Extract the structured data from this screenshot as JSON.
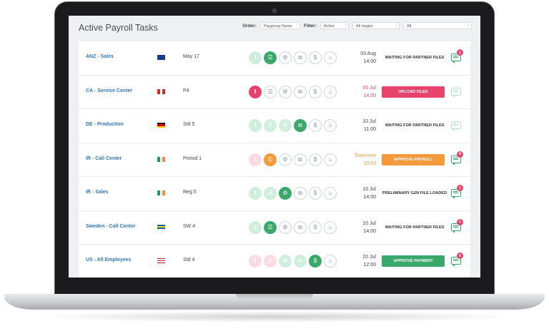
{
  "header": {
    "title": "Active Payroll Tasks",
    "order_label": "Order:",
    "order_value": "Paygroup Name",
    "filter_label": "Filter:",
    "filter_status": "Active",
    "filter_stages": "All stages",
    "filter_all": "All"
  },
  "colors": {
    "green": "#3aa86b",
    "green_light": "#cfeedd",
    "pink": "#e8436d",
    "pink_light": "#fadbe3",
    "orange": "#f39a3d",
    "orange_light": "#fde3c9",
    "link": "#3277b7"
  },
  "stage_icons": [
    "pause-icon",
    "document-icon",
    "gears-icon",
    "copy-icon",
    "money-bag-icon",
    "bank-icon"
  ],
  "rows": [
    {
      "name": "ANZ - Sales",
      "flag": "australia-flag",
      "period": "May 17",
      "stages": [
        "done-green",
        "active-green",
        "future",
        "future",
        "future",
        "future"
      ],
      "date": "03 Aug",
      "time": "14:00",
      "late": false,
      "status": "WAITING FOR PARTNER FILES",
      "status_kind": "text",
      "badge": "1",
      "chat_muted": false
    },
    {
      "name": "CA - Service Center",
      "flag": "canada-flag",
      "period": "P4",
      "stages": [
        "active-pink",
        "future",
        "future",
        "future",
        "future",
        "future"
      ],
      "date": "05 Jul",
      "time": "14:00",
      "late": true,
      "status": "UPLOAD FILES",
      "status_kind": "pink",
      "badge": "",
      "chat_muted": true
    },
    {
      "name": "DE - Production",
      "flag": "germany-flag",
      "period": "Std 5",
      "stages": [
        "done-green",
        "done-green",
        "done-green",
        "active-green",
        "future",
        "future"
      ],
      "date": "10 Jul",
      "time": "11:00",
      "late": false,
      "status": "WAITING FOR PARTNER FILES",
      "status_kind": "text",
      "badge": "",
      "chat_muted": true
    },
    {
      "name": "IR - Call Center",
      "flag": "ireland-flag",
      "period": "Period 1",
      "stages": [
        "done-pink",
        "active-orange",
        "future",
        "future",
        "future",
        "future"
      ],
      "date": "Tomorrow",
      "time": "10:00",
      "late": "orange",
      "status": "APPROVE PAYROLL",
      "status_kind": "orange",
      "badge": "8",
      "chat_muted": false
    },
    {
      "name": "IR - Sales",
      "flag": "ireland-flag",
      "period": "Reg 5",
      "stages": [
        "done-green",
        "done-green",
        "active-green",
        "future",
        "future",
        "future"
      ],
      "date": "10 Jul",
      "time": "14:00",
      "late": false,
      "status": "PRELIMINARY G2N FILE LOADED",
      "status_kind": "text",
      "badge": "1",
      "chat_muted": false
    },
    {
      "name": "Sweden - Call Center",
      "flag": "sweden-flag",
      "period": "SW 4",
      "stages": [
        "done-green",
        "active-green",
        "future",
        "future",
        "future",
        "future"
      ],
      "date": "10 Jul",
      "time": "14:00",
      "late": false,
      "status": "WAITING FOR PARTNER FILES",
      "status_kind": "text",
      "badge": "1",
      "chat_muted": false
    },
    {
      "name": "US - All Employees",
      "flag": "usa-flag",
      "period": "Std 4",
      "stages": [
        "done-pink",
        "done-pink",
        "done-green",
        "done-green",
        "active-green",
        "future"
      ],
      "date": "20 Jul",
      "time": "12:00",
      "late": false,
      "status": "APPROVE PAYMENT",
      "status_kind": "green",
      "badge": "6",
      "chat_muted": false
    }
  ]
}
